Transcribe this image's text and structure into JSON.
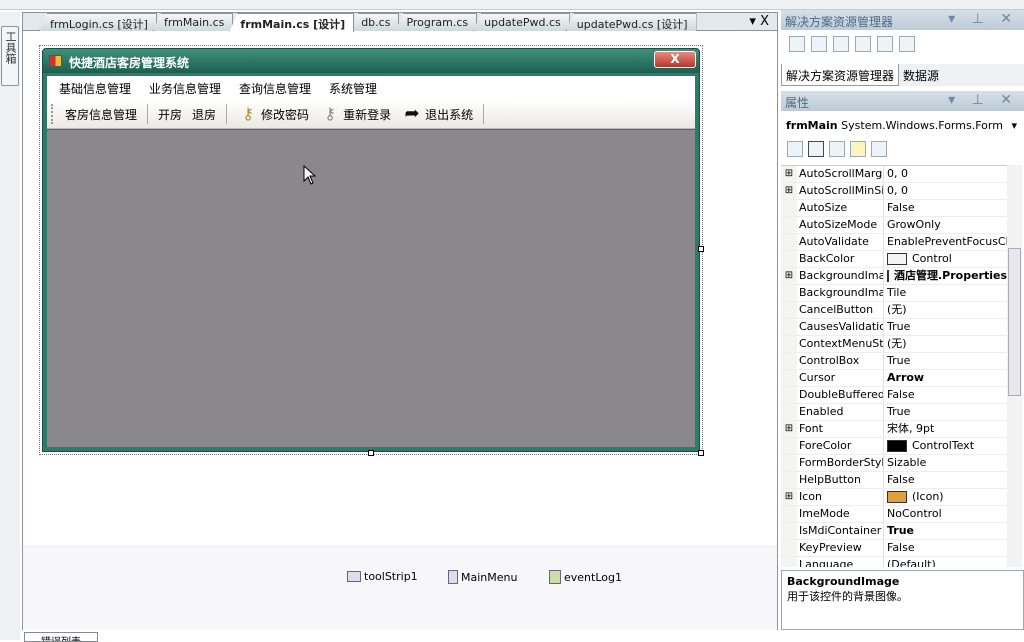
{
  "toolbox": {
    "label": "工具箱"
  },
  "tabs": [
    {
      "label": "frmLogin.cs [设计]"
    },
    {
      "label": "frmMain.cs"
    },
    {
      "label": "frmMain.cs [设计]",
      "active": true
    },
    {
      "label": "db.cs"
    },
    {
      "label": "Program.cs"
    },
    {
      "label": "updatePwd.cs"
    },
    {
      "label": "updatePwd.cs [设计]"
    }
  ],
  "tab_controls": "▾ X",
  "form": {
    "title": "快捷酒店客房管理系统",
    "close": "X",
    "client_color": "#8a878d",
    "menu": [
      "基础信息管理",
      "业务信息管理",
      "查询信息管理",
      "系统管理"
    ],
    "toolstrip": {
      "room_info": "客房信息管理",
      "check_in": "开房",
      "check_out": "退房",
      "change_pwd": "修改密码",
      "relogin": "重新登录",
      "exit": "退出系统"
    }
  },
  "tray": [
    "toolStrip1",
    "MainMenu",
    "eventLog1"
  ],
  "solution_explorer": {
    "title": "解决方案资源管理器",
    "tab1": "解决方案资源管理器",
    "tab2": "数据源"
  },
  "properties": {
    "title": "属性",
    "object_name": "frmMain",
    "object_type": "System.Windows.Forms.Form",
    "rows": [
      {
        "exp": "⊞",
        "name": "AutoScrollMargin",
        "value": "0, 0"
      },
      {
        "exp": "⊞",
        "name": "AutoScrollMinSize",
        "value": "0, 0"
      },
      {
        "exp": "",
        "name": "AutoSize",
        "value": "False"
      },
      {
        "exp": "",
        "name": "AutoSizeMode",
        "value": "GrowOnly"
      },
      {
        "exp": "",
        "name": "AutoValidate",
        "value": "EnablePreventFocusChange"
      },
      {
        "exp": "",
        "name": "BackColor",
        "value": "Control",
        "swatch": "#f4f4f4"
      },
      {
        "exp": "⊞",
        "name": "BackgroundImage",
        "value": "酒店管理.Properties",
        "swatch": "#b89a6a",
        "bold": true
      },
      {
        "exp": "",
        "name": "BackgroundImageLayout",
        "value": "Tile"
      },
      {
        "exp": "",
        "name": "CancelButton",
        "value": "(无)"
      },
      {
        "exp": "",
        "name": "CausesValidation",
        "value": "True"
      },
      {
        "exp": "",
        "name": "ContextMenuStrip",
        "value": "(无)"
      },
      {
        "exp": "",
        "name": "ControlBox",
        "value": "True"
      },
      {
        "exp": "",
        "name": "Cursor",
        "value": "Arrow",
        "bold": true
      },
      {
        "exp": "",
        "name": "DoubleBuffered",
        "value": "False"
      },
      {
        "exp": "",
        "name": "Enabled",
        "value": "True"
      },
      {
        "exp": "⊞",
        "name": "Font",
        "value": "宋体, 9pt"
      },
      {
        "exp": "",
        "name": "ForeColor",
        "value": "ControlText",
        "swatch": "#000000"
      },
      {
        "exp": "",
        "name": "FormBorderStyle",
        "value": "Sizable"
      },
      {
        "exp": "",
        "name": "HelpButton",
        "value": "False"
      },
      {
        "exp": "⊞",
        "name": "Icon",
        "value": "(Icon)",
        "swatch": "#e0a040"
      },
      {
        "exp": "",
        "name": "ImeMode",
        "value": "NoControl"
      },
      {
        "exp": "",
        "name": "IsMdiContainer",
        "value": "True",
        "bold": true
      },
      {
        "exp": "",
        "name": "KeyPreview",
        "value": "False"
      },
      {
        "exp": "",
        "name": "Language",
        "value": "(Default)"
      }
    ],
    "desc_title": "BackgroundImage",
    "desc_text": "用于该控件的背景图像。"
  },
  "bottom_tab": "错误列表"
}
